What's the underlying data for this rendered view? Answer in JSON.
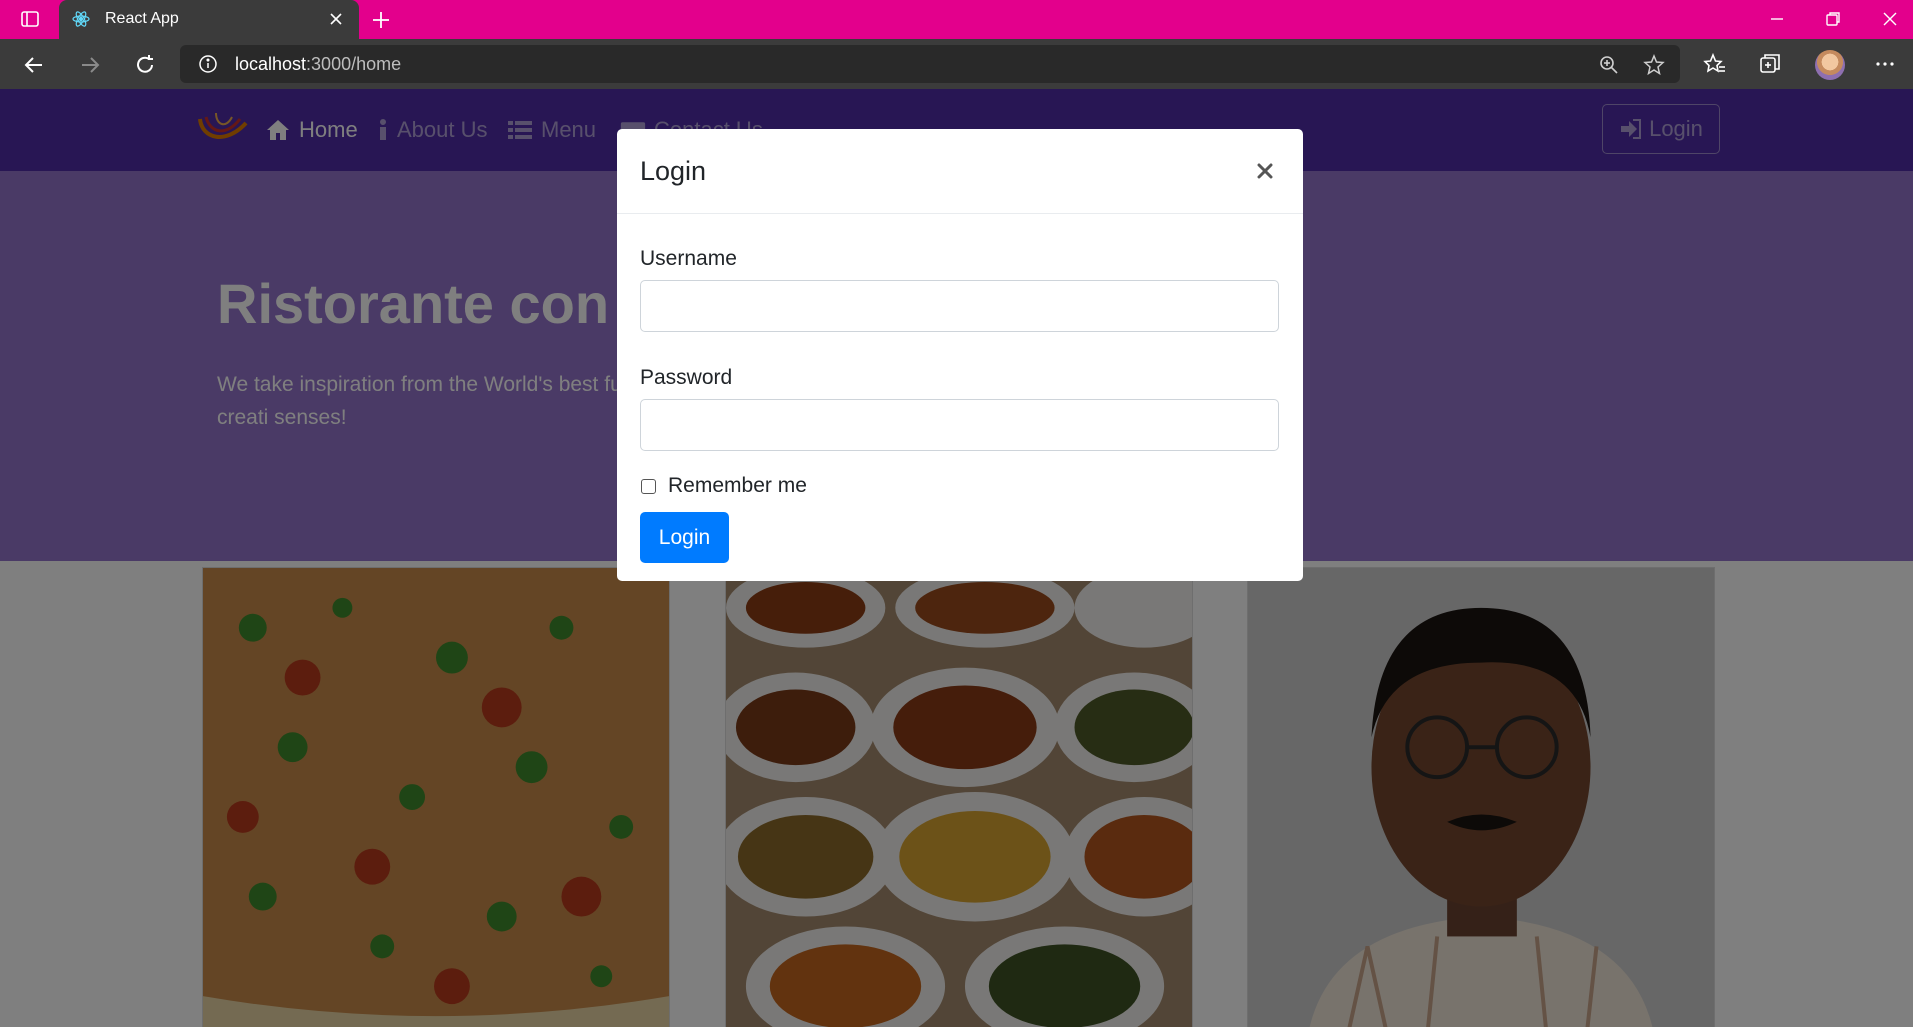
{
  "browser": {
    "tab_title": "React App",
    "url_host": "localhost",
    "url_path": ":3000/home",
    "accent_color": "#e3008c"
  },
  "site": {
    "nav": {
      "home_label": "Home",
      "about_label": "About Us",
      "menu_label": "Menu",
      "contact_label": "Contact Us",
      "login_label": "Login"
    },
    "jumbotron": {
      "title": "Ristorante con F",
      "text": "We take inspiration from the World's best fusion experience. Our lipsmacking creati senses!"
    },
    "colors": {
      "primary": "#512da8",
      "jumbotron": "#9575cd"
    },
    "cards": [
      {
        "icon": "pizza-image"
      },
      {
        "icon": "buffet-dishes-image"
      },
      {
        "icon": "person-photo"
      }
    ]
  },
  "modal": {
    "title": "Login",
    "username_label": "Username",
    "username_value": "",
    "password_label": "Password",
    "password_value": "",
    "remember_label": "Remember me",
    "remember_checked": false,
    "submit_label": "Login",
    "submit_color": "#007bff"
  }
}
